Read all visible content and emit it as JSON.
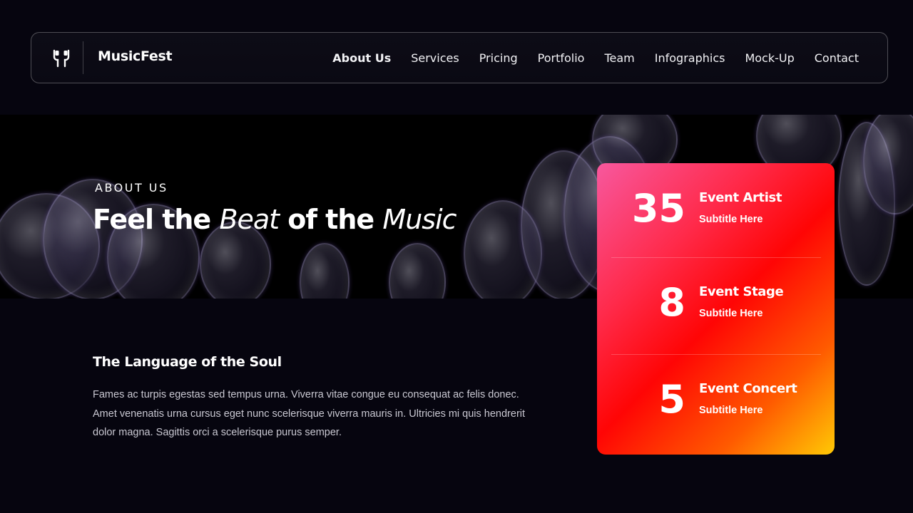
{
  "brand": {
    "name": "MusicFest",
    "logo_icon": "speaker-plugs-icon"
  },
  "nav": {
    "items": [
      {
        "label": "About Us",
        "active": true
      },
      {
        "label": "Services"
      },
      {
        "label": "Pricing"
      },
      {
        "label": "Portfolio"
      },
      {
        "label": "Team"
      },
      {
        "label": "Infographics"
      },
      {
        "label": "Mock-Up"
      },
      {
        "label": "Contact"
      }
    ]
  },
  "hero": {
    "eyebrow": "ABOUT US",
    "title_parts": [
      "Feel the ",
      "Beat",
      " of the ",
      "Music"
    ]
  },
  "about": {
    "heading": "The Language of the Soul",
    "body": "Fames ac turpis egestas sed tempus urna. Viverra vitae congue eu consequat ac felis donec. Amet venenatis urna cursus eget nunc scelerisque viverra mauris in. Ultricies mi quis hendrerit dolor magna. Sagittis orci a scelerisque purus semper."
  },
  "stats": [
    {
      "number": "35",
      "title": "Event Artist",
      "subtitle": "Subtitle Here"
    },
    {
      "number": "8",
      "title": "Event Stage",
      "subtitle": "Subtitle Here"
    },
    {
      "number": "5",
      "title": "Event Concert",
      "subtitle": "Subtitle Here"
    }
  ],
  "colors": {
    "page_bg": "#06050f",
    "card_gradient": [
      "#f7589e",
      "#ff0505",
      "#ffc905"
    ]
  }
}
